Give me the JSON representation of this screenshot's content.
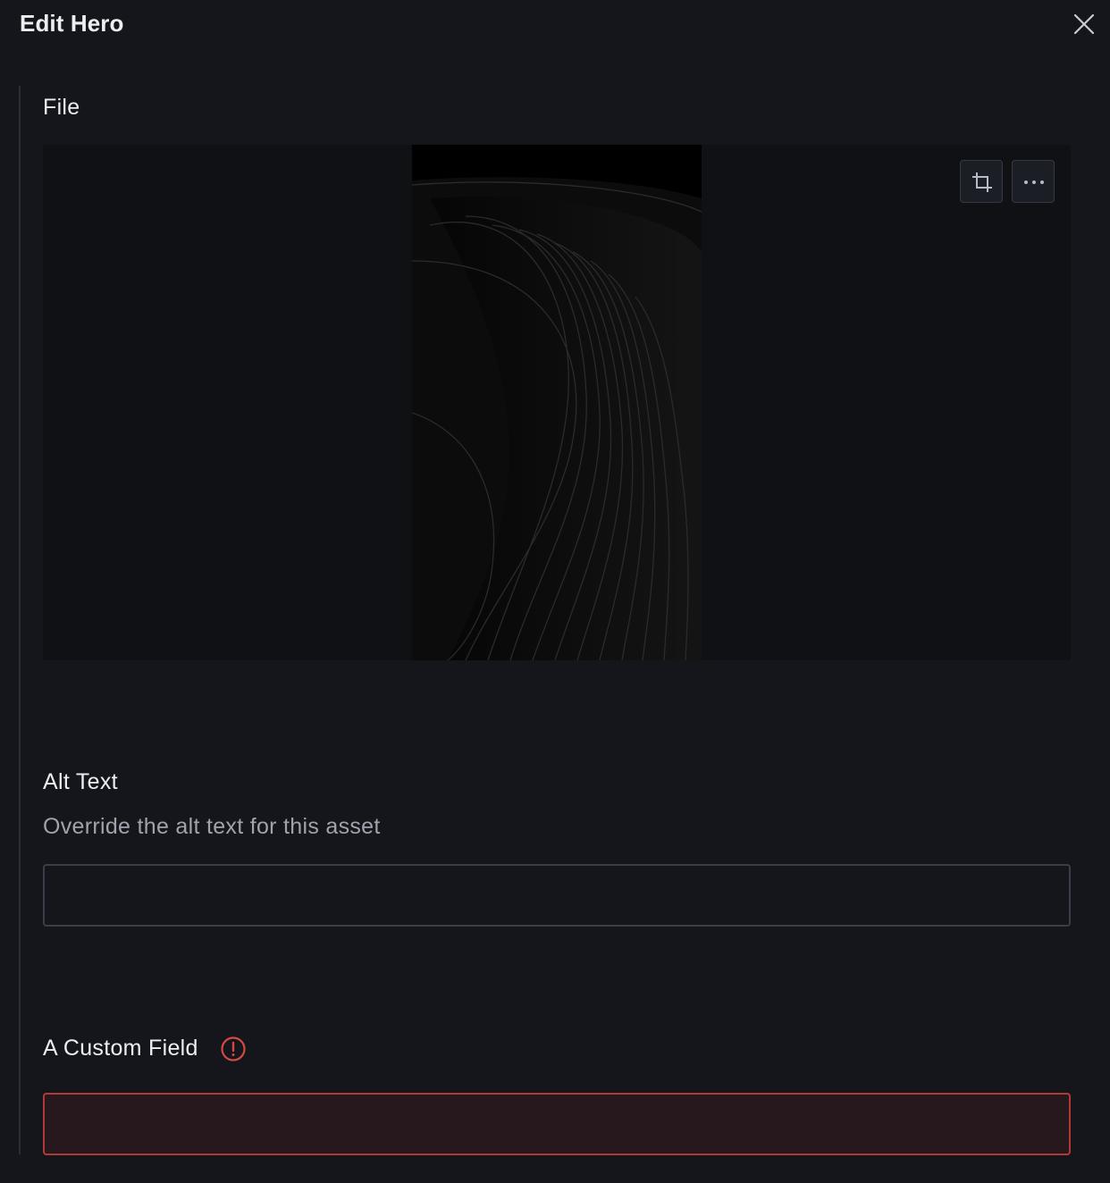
{
  "dialog": {
    "title": "Edit Hero",
    "close_icon": "close-icon"
  },
  "file_field": {
    "label": "File",
    "image_alt": "dark abstract wave layers",
    "toolbar": {
      "crop_icon": "crop-icon",
      "more_icon": "ellipsis-icon"
    }
  },
  "alt_text_field": {
    "label": "Alt Text",
    "description": "Override the alt text for this asset",
    "value": ""
  },
  "custom_field": {
    "label": "A Custom Field",
    "status_icon": "error-circle-icon",
    "value": ""
  },
  "colors": {
    "background": "#14161b",
    "preview_background": "#0f1115",
    "error": "#d24a42",
    "input_border": "#3a3e4a"
  }
}
